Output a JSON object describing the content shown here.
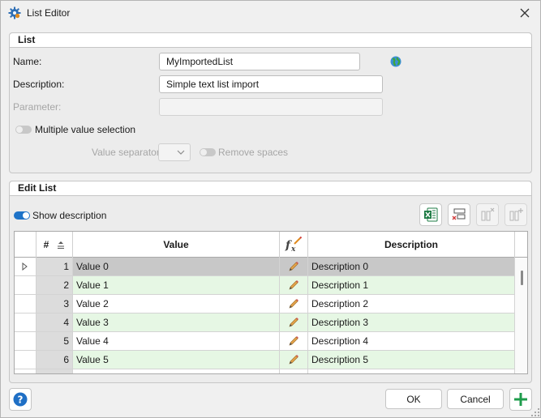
{
  "window": {
    "title": "List Editor",
    "icon": "gear-icon"
  },
  "list_group": {
    "header": "List",
    "name_label": "Name:",
    "name_value": "MyImportedList",
    "description_label": "Description:",
    "description_value": "Simple text list import",
    "parameter_label": "Parameter:",
    "parameter_value": "",
    "multiple_selection_label": "Multiple value selection",
    "multiple_selection_on": false,
    "value_separator_label": "Value separator",
    "remove_spaces_label": "Remove spaces",
    "remove_spaces_on": false
  },
  "edit_group": {
    "header": "Edit List",
    "show_description_label": "Show description",
    "show_description_on": true,
    "toolbar_icons": [
      "excel-export-icon",
      "delete-rows-icon",
      "remove-column-icon",
      "add-column-icon"
    ]
  },
  "grid": {
    "columns": {
      "num": "#",
      "value": "Value",
      "fx": "fx-icon",
      "description": "Description"
    },
    "rows": [
      {
        "num": "1",
        "value": "Value 0",
        "description": "Description 0",
        "current": true
      },
      {
        "num": "2",
        "value": "Value 1",
        "description": "Description 1"
      },
      {
        "num": "3",
        "value": "Value 2",
        "description": "Description 2"
      },
      {
        "num": "4",
        "value": "Value 3",
        "description": "Description 3"
      },
      {
        "num": "5",
        "value": "Value 4",
        "description": "Description 4"
      },
      {
        "num": "6",
        "value": "Value 5",
        "description": "Description 5"
      },
      {
        "num": "",
        "value": "",
        "description": ""
      }
    ],
    "even_row_color": "#e6f7e4",
    "current_row_color": "#c8c8c8"
  },
  "footer": {
    "ok_label": "OK",
    "cancel_label": "Cancel"
  },
  "colors": {
    "accent": "#1e73c8",
    "add_green": "#1f9c4c"
  }
}
